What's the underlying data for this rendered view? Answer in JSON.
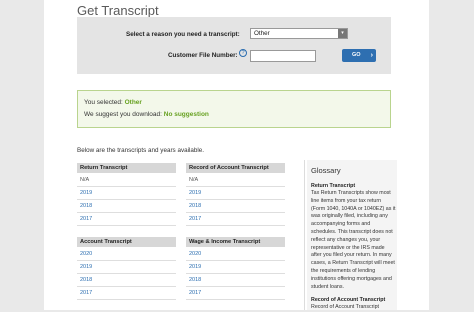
{
  "page": {
    "title": "Get Transcript"
  },
  "form": {
    "reason_label": "Select a reason you need a transcript:",
    "reason_value": "Other",
    "file_number_label": "Customer File Number:",
    "help_icon_text": "?",
    "go_label": "GO",
    "go_chevron": "›",
    "select_arrow": "▾"
  },
  "selection": {
    "selected_prefix": "You selected:",
    "selected_value": "Other",
    "suggest_prefix": "We suggest you download:",
    "suggest_value": "No suggestion"
  },
  "below_text": "Below are the transcripts and years available.",
  "transcripts": {
    "return": {
      "title": "Return Transcript",
      "rows": [
        "N/A",
        "2019",
        "2018",
        "2017"
      ]
    },
    "record": {
      "title": "Record of Account Transcript",
      "rows": [
        "N/A",
        "2019",
        "2018",
        "2017"
      ]
    },
    "account": {
      "title": "Account Transcript",
      "rows": [
        "2020",
        "2019",
        "2018",
        "2017"
      ]
    },
    "wage": {
      "title": "Wage & Income Transcript",
      "rows": [
        "2020",
        "2019",
        "2018",
        "2017"
      ]
    }
  },
  "glossary": {
    "title": "Glossary",
    "term1": "Return Transcript",
    "def1": [
      "Tax Return Transcripts show most",
      "line items from your tax return",
      "(Form 1040, 1040A or 1040EZ) as it",
      "was originally filed, including any",
      "accompanying forms and",
      "schedules. This transcript does not",
      "reflect any changes you, your",
      "representative or the IRS made",
      "after you filed your return. In many",
      "cases, a Return Transcript will meet",
      "the requirements of lending",
      "institutions offering mortgages and",
      "student loans."
    ],
    "term2": "Record of Account Transcript",
    "def2_start": "Record of Account Transcript"
  },
  "colors": {
    "link": "#2a6db0",
    "go": "#2e6fb1",
    "success_green": "#67a121"
  }
}
